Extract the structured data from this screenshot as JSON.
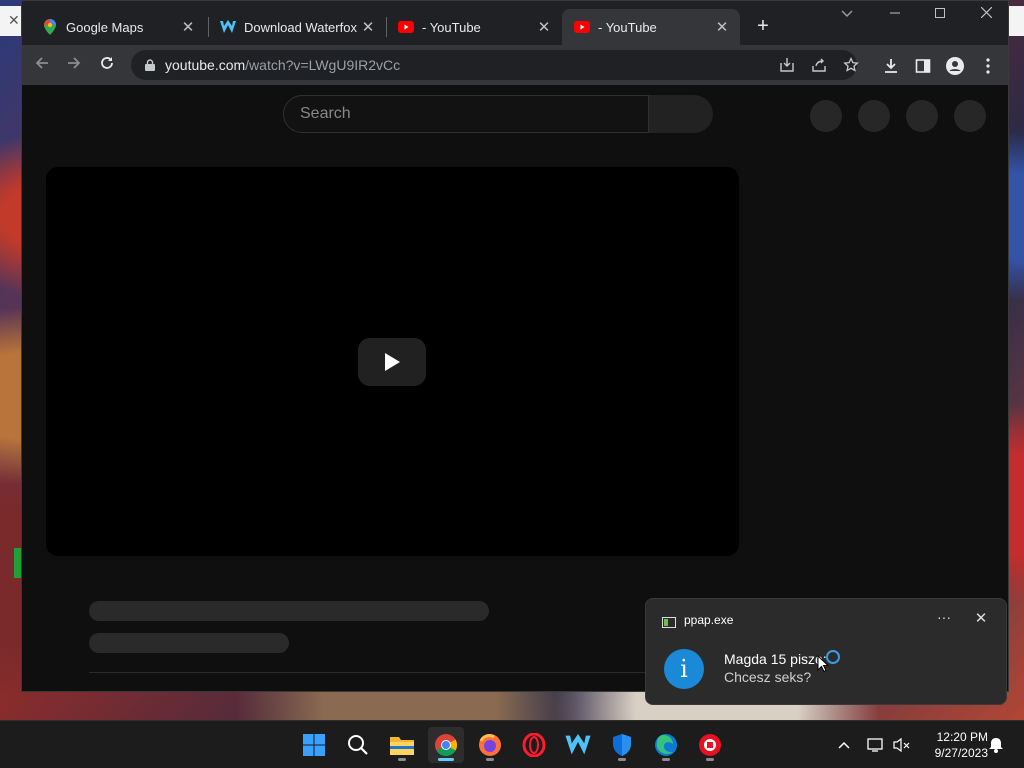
{
  "browser": {
    "tabs": [
      {
        "label": "Google Maps",
        "icon": "google-maps-icon",
        "active": false
      },
      {
        "label": "Download Waterfox",
        "icon": "waterfox-icon",
        "active": false
      },
      {
        "label": "- YouTube",
        "icon": "youtube-icon",
        "active": false
      },
      {
        "label": "- YouTube",
        "icon": "youtube-icon",
        "active": true
      }
    ],
    "new_tab_label": "+",
    "url_host": "youtube.com",
    "url_path": "/watch?v=LWgU9IR2vCc"
  },
  "page": {
    "search_placeholder": "Search"
  },
  "notification": {
    "app_name": "ppap.exe",
    "more_label": "···",
    "close_label": "✕",
    "info_glyph": "i",
    "title": "Magda 15 pisze:",
    "body": "Chcesz seks?"
  },
  "taskbar": {
    "apps": [
      "start-icon",
      "search-icon",
      "file-explorer-icon",
      "chrome-icon",
      "firefox-icon",
      "opera-icon",
      "waterfox-icon",
      "defender-icon",
      "edge-icon",
      "record-icon"
    ],
    "time": "12:20 PM",
    "date": "9/27/2023"
  },
  "colors": {
    "accent": "#60cdff",
    "youtube_red": "#ff0000",
    "info_blue": "#1a8ad8"
  }
}
